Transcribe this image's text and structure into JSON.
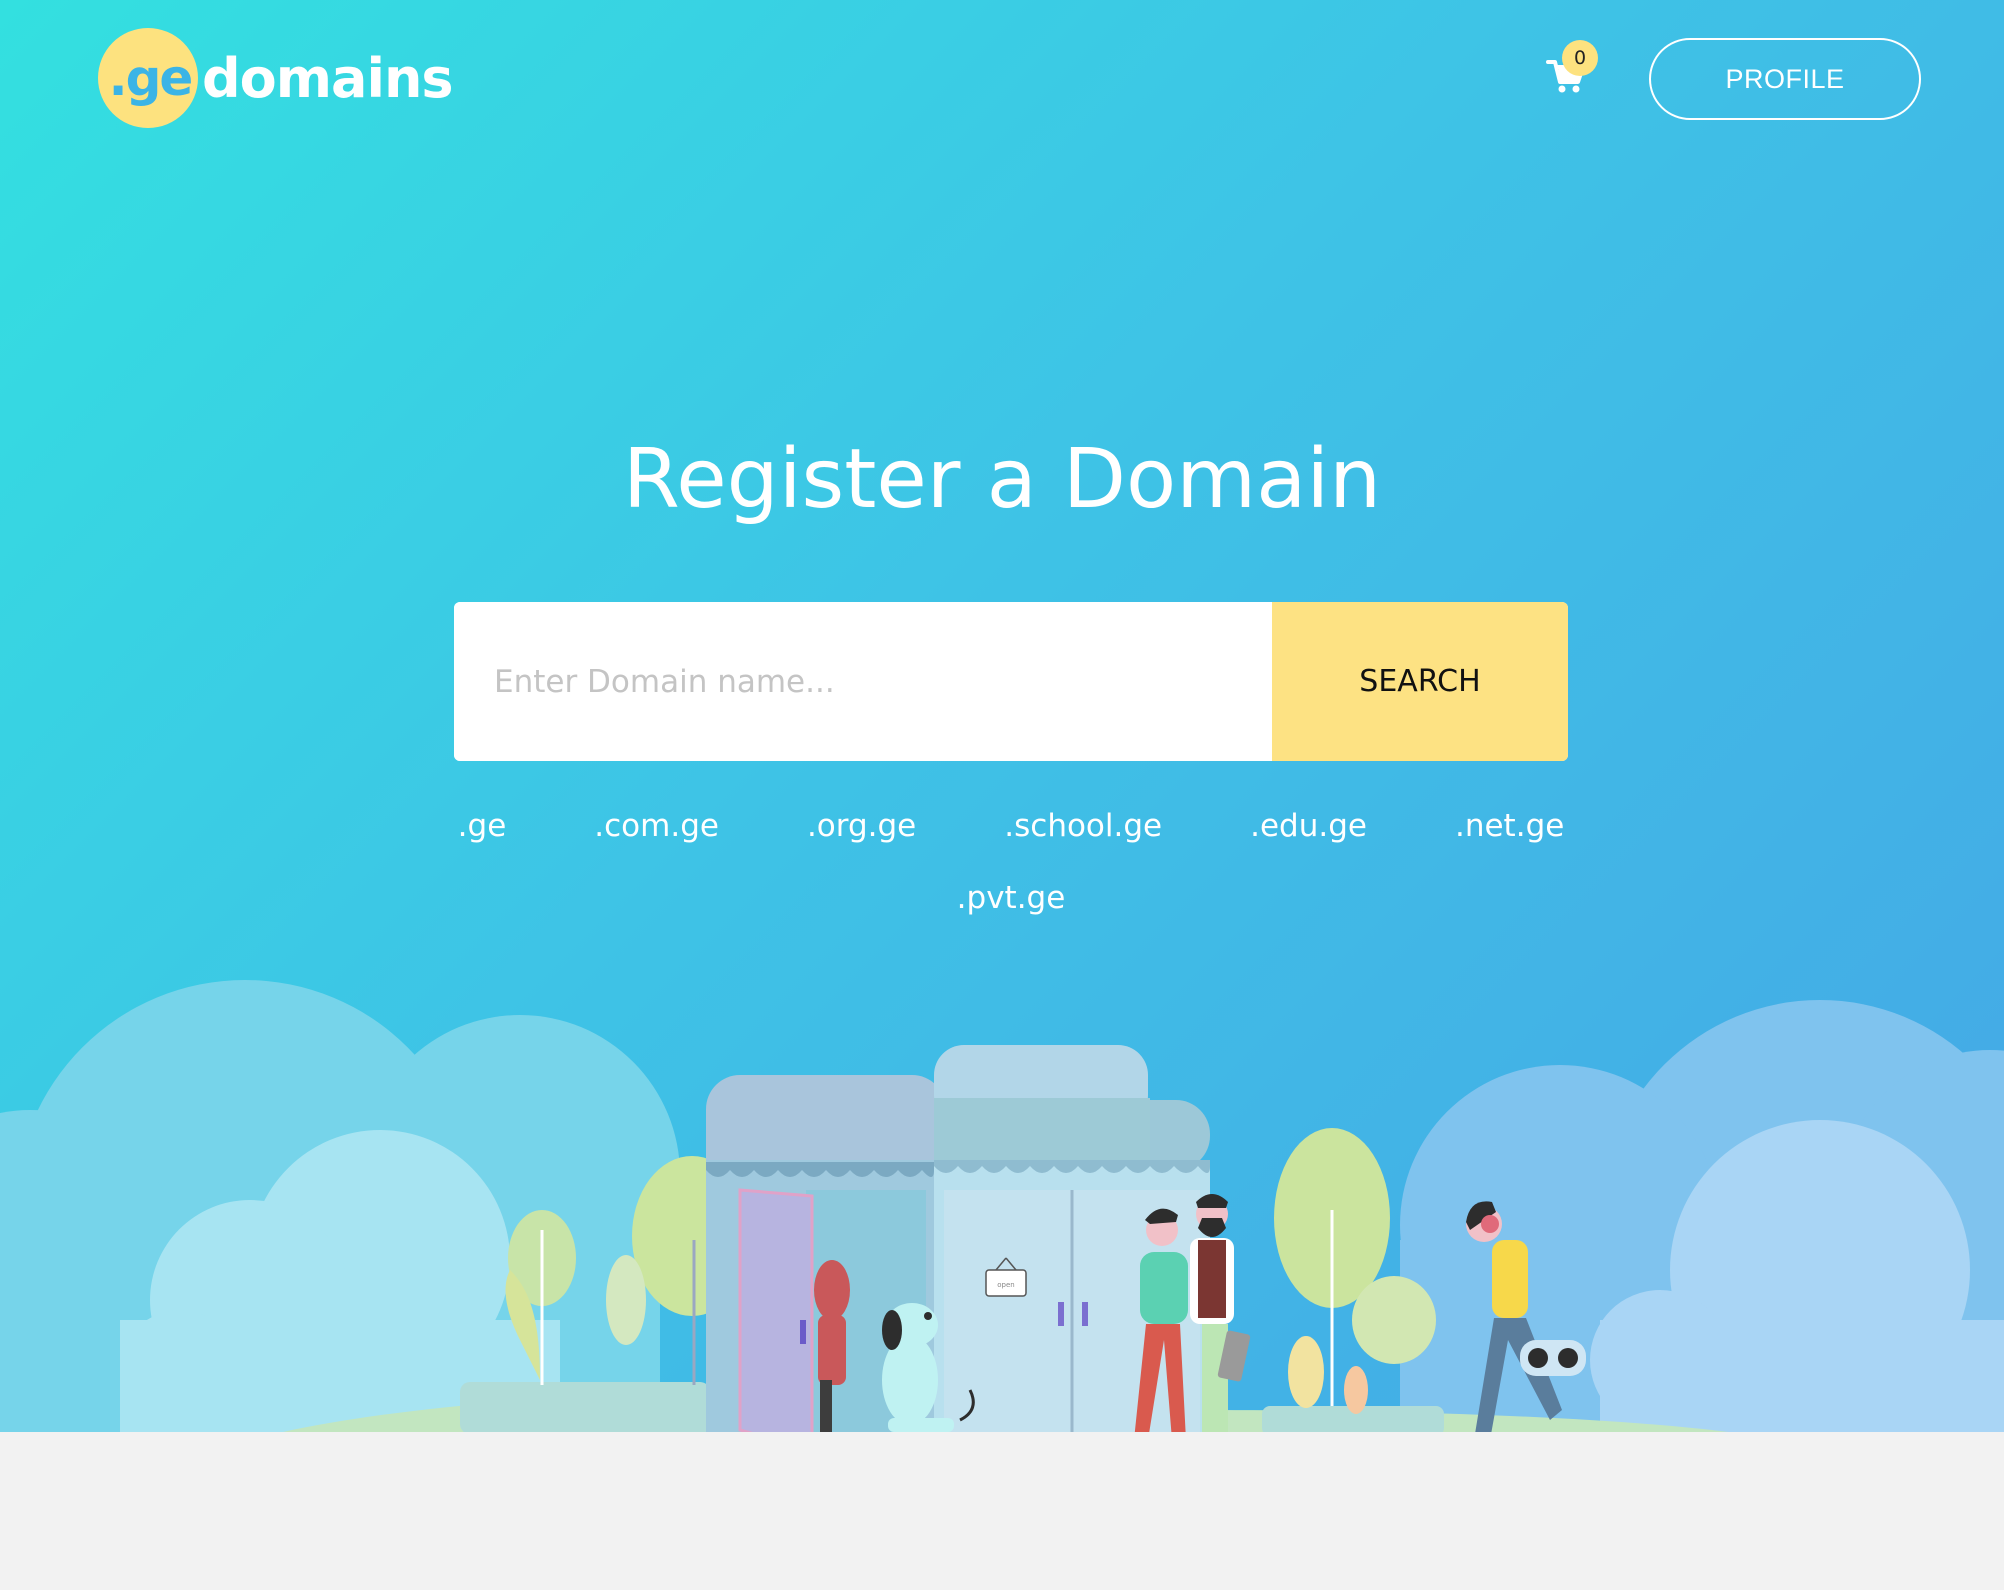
{
  "brand": {
    "logo_prefix": ".ge",
    "logo_word": "domains"
  },
  "header": {
    "cart_count": "0",
    "profile_label": "PROFILE"
  },
  "hero": {
    "title": "Register a Domain",
    "search": {
      "placeholder": "Enter Domain name...",
      "value": "",
      "button_label": "SEARCH"
    },
    "tlds": [
      ".ge",
      ".com.ge",
      ".org.ge",
      ".school.ge",
      ".edu.ge",
      ".net.ge",
      ".pvt.ge"
    ]
  },
  "illustration": {
    "sign_text": "open"
  },
  "colors": {
    "accent_yellow": "#fde283",
    "gradient_start": "#33e0e0",
    "gradient_end": "#45a6e6",
    "text_white": "#ffffff"
  },
  "icons": [
    "cart-icon"
  ]
}
